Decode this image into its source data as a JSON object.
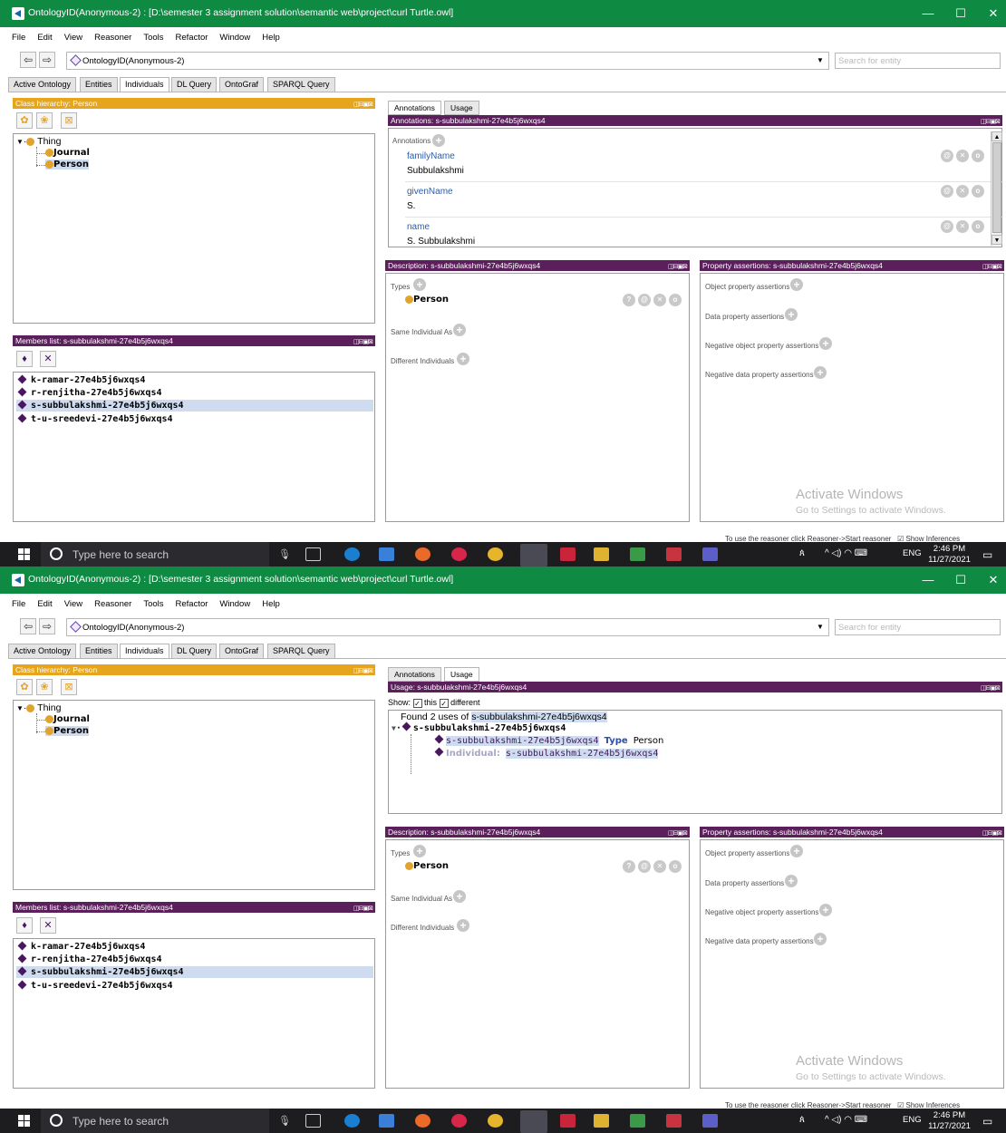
{
  "window": {
    "title": "OntologyID(Anonymous-2) : [D:\\semester 3 assignment solution\\semantic web\\project\\curl Turtle.owl]",
    "minimize": "—",
    "maximize": "☐",
    "close": "✕"
  },
  "menu": [
    "File",
    "Edit",
    "View",
    "Reasoner",
    "Tools",
    "Refactor",
    "Window",
    "Help"
  ],
  "toolbar": {
    "ontology_name": "OntologyID(Anonymous-2)",
    "search_placeholder": "Search for entity"
  },
  "tabs": [
    "Active Ontology",
    "Entities",
    "Individuals",
    "DL Query",
    "OntoGraf",
    "SPARQL Query"
  ],
  "active_tab": "Individuals",
  "class_hierarchy": {
    "header": "Class hierarchy: Person",
    "root": "Thing",
    "children": [
      "Journal",
      "Person"
    ],
    "selected": "Person"
  },
  "members": {
    "header": "Members list: s-subbulakshmi-27e4b5j6wxqs4",
    "items": [
      "k-ramar-27e4b5j6wxqs4",
      "r-renjitha-27e4b5j6wxqs4",
      "s-subbulakshmi-27e4b5j6wxqs4",
      "t-u-sreedevi-27e4b5j6wxqs4"
    ],
    "selected_index": 2
  },
  "right_tabs": [
    "Annotations",
    "Usage"
  ],
  "annotations_view": {
    "header": "Annotations: s-subbulakshmi-27e4b5j6wxqs4",
    "section_label": "Annotations",
    "entries": [
      {
        "property": "familyName",
        "value": "Subbulakshmi"
      },
      {
        "property": "givenName",
        "value": "S."
      },
      {
        "property": "name",
        "value": "S. Subbulakshmi"
      }
    ]
  },
  "usage_view": {
    "header": "Usage: s-subbulakshmi-27e4b5j6wxqs4",
    "show_label": "Show:",
    "this_label": "this",
    "different_label": "different",
    "found_prefix": "Found 2 uses of",
    "entity": "s-subbulakshmi-27e4b5j6wxqs4",
    "tree_root": "s-subbulakshmi-27e4b5j6wxqs4",
    "line1_subject": "s-subbulakshmi-27e4b5j6wxqs4",
    "line1_keyword": "Type",
    "line1_object": "Person",
    "line2_keyword": "Individual:",
    "line2_object": "s-subbulakshmi-27e4b5j6wxqs4"
  },
  "description": {
    "header": "Description: s-subbulakshmi-27e4b5j6wxqs4",
    "types_label": "Types",
    "type_value": "Person",
    "same_label": "Same Individual As",
    "different_label": "Different Individuals"
  },
  "property_assertions": {
    "header": "Property assertions: s-subbulakshmi-27e4b5j6wxqs4",
    "sections": [
      "Object property assertions",
      "Data property assertions",
      "Negative object property assertions",
      "Negative data property assertions"
    ]
  },
  "watermark": {
    "title": "Activate Windows",
    "subtitle": "Go to Settings to activate Windows."
  },
  "status": {
    "reasoner_hint": "To use the reasoner click Reasoner->Start reasoner",
    "show_inferences": "Show Inferences"
  },
  "taskbar": {
    "search_placeholder": "Type here to search",
    "language": "ENG",
    "time": "2:46 PM",
    "date": "11/27/2021"
  },
  "colors": {
    "title_bar": "#0e8a43",
    "hierarchy_header": "#e6a51d",
    "view_header": "#5b1f5c",
    "property_link": "#2b5da8",
    "selection": "#cfdcf0"
  }
}
